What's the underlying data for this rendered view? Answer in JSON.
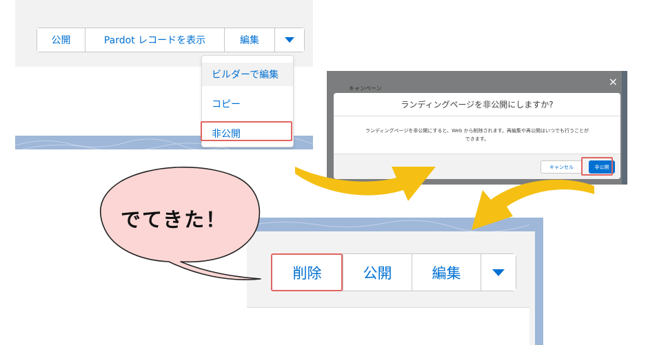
{
  "step1": {
    "buttons": [
      "公開",
      "Pardot レコードを表示",
      "編集"
    ],
    "dropdown": [
      "ビルダーで編集",
      "コピー",
      "非公開"
    ]
  },
  "step2": {
    "background_label": "キャンペーン",
    "close": "×",
    "title": "ランディングページを非公開にしますか?",
    "message_line1": "ランディングページを非公開にすると、Web から削除されます。再編集や再公開はいつでも行うことが",
    "message_line2": "できます。",
    "cancel": "キャンセル",
    "confirm": "非公開"
  },
  "step3": {
    "buttons": [
      "削除",
      "公開",
      "編集"
    ]
  },
  "bubble_text": "でてきた！",
  "colors": {
    "link_blue": "#0070d2",
    "highlight_red": "#e06460",
    "arrow_yellow": "#f5c013",
    "bubble_pink": "#fbd6d4"
  }
}
